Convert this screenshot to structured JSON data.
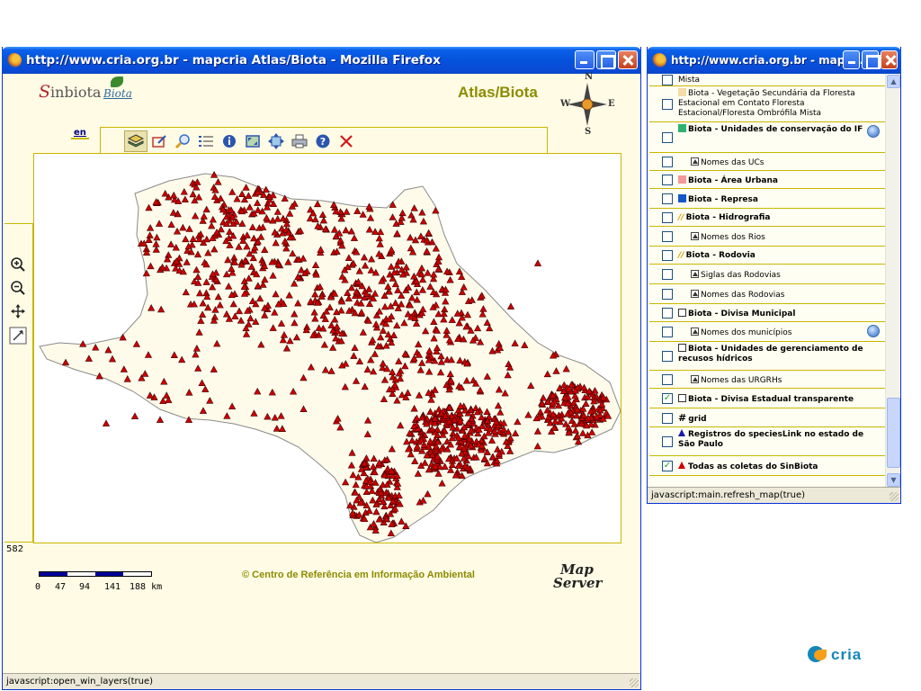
{
  "main_window": {
    "title": "http://www.cria.org.br - mapcria Atlas/Biota - Mozilla Firefox",
    "logo_sinbiota": "inbiota",
    "logo_sinbiota_initial": "S",
    "logo_biota": "Biota",
    "atlas_title": "Atlas/Biota",
    "compass": {
      "n": "N",
      "s": "S",
      "e": "E",
      "w": "W"
    },
    "language_link": "en",
    "toolbar_icons": [
      "layers-icon",
      "edit-icon",
      "search-icon",
      "list-icon",
      "info-icon",
      "fullextent-icon",
      "move-icon",
      "print-icon",
      "help-icon",
      "close-icon"
    ],
    "left_tools": [
      "zoom-in-icon",
      "zoom-out-icon",
      "pan-icon",
      "zoom-box-icon"
    ],
    "scale_number": "582",
    "scale_labels": [
      "0",
      "47",
      "94",
      "141",
      "188 km"
    ],
    "copyright": "© Centro de Referência em Informação Ambiental",
    "mapserver_logo": [
      "Map",
      "Server"
    ],
    "status": "javascript:open_win_layers(true)",
    "map": {
      "land_color": "#fffbeb",
      "marker_color": "#cc0000"
    }
  },
  "layers_window": {
    "title": "http://www.cria.org.br - mapc...",
    "status": "javascript:main.refresh_map(true)",
    "rows": [
      {
        "text": "Mista",
        "checked": false,
        "style": "plain"
      },
      {
        "text": "Biota - Vegetação Secundária da Floresta Estacional em Contato Floresta Estacional/Floresta Ombrófila Mista",
        "checked": false,
        "style": "plain",
        "swatch": "#f3dca6"
      },
      {
        "text": "Biota - Unidades de conservação do IF",
        "checked": false,
        "style": "bold",
        "swatch": "#2db36f",
        "globe": true
      },
      {
        "text": "Nomes das UCs",
        "checked": false,
        "style": "sub"
      },
      {
        "text": "Biota - Área Urbana",
        "checked": false,
        "style": "bold",
        "swatch": "#f29999"
      },
      {
        "text": "Biota - Represa",
        "checked": false,
        "style": "bold",
        "swatch": "#1457c6"
      },
      {
        "text": "Biota - Hidrografia",
        "checked": false,
        "style": "bold",
        "icon": "line-icon"
      },
      {
        "text": "Nomes dos Rios",
        "checked": false,
        "style": "sub"
      },
      {
        "text": "Biota - Rodovia",
        "checked": false,
        "style": "bold",
        "icon": "line-icon"
      },
      {
        "text": "Siglas das Rodovias",
        "checked": false,
        "style": "sub"
      },
      {
        "text": "Nomes das Rodovias",
        "checked": false,
        "style": "sub"
      },
      {
        "text": "Biota - Divisa Municipal",
        "checked": false,
        "style": "bold",
        "icon": "outline"
      },
      {
        "text": "Nomes dos municípios",
        "checked": false,
        "style": "sub",
        "globe": true
      },
      {
        "text": "Biota - Unidades de gerenciamento de recusos hídricos",
        "checked": false,
        "style": "bold",
        "icon": "outline"
      },
      {
        "text": "Nomes das URGRHs",
        "checked": false,
        "style": "sub"
      },
      {
        "text": "Biota - Divisa Estadual transparente",
        "checked": true,
        "style": "bold",
        "icon": "outline"
      },
      {
        "text": "grid",
        "checked": false,
        "style": "bold",
        "icon": "hash"
      },
      {
        "text": "Registros do speciesLink no estado de São Paulo",
        "checked": false,
        "style": "bold",
        "icon": "triangle",
        "icon_color": "#1a1aa8"
      },
      {
        "text": "Todas as coletas do SinBiota",
        "checked": true,
        "style": "bold",
        "icon": "triangle",
        "icon_color": "#cc0000"
      }
    ]
  },
  "cria_logo": "cria"
}
